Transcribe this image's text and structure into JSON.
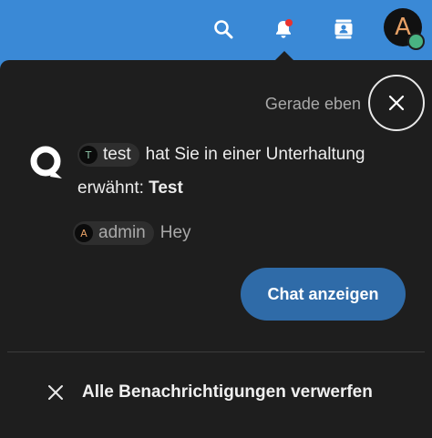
{
  "header": {
    "icons": {
      "search": "search-icon",
      "notifications": "bell-icon",
      "contacts": "contacts-icon"
    },
    "avatar_letter": "A",
    "status": "online"
  },
  "notification": {
    "time": "Gerade eben",
    "app_icon": "talk-icon",
    "actor": {
      "initial": "T",
      "name": "test"
    },
    "message_text": "hat Sie in einer Unterhaltung",
    "message_prefix": "erwähnt:",
    "conversation": "Test",
    "quote": {
      "author_initial": "A",
      "author_name": "admin",
      "text": "Hey"
    },
    "action_label": "Chat anzeigen"
  },
  "footer": {
    "dismiss_all_label": "Alle Benachrichtigungen verwerfen"
  },
  "colors": {
    "header_bg": "#3a89d6",
    "panel_bg": "#1e1e1e",
    "primary_button": "#2f6ba8",
    "online": "#49b382",
    "unread_dot": "#e9322d"
  }
}
